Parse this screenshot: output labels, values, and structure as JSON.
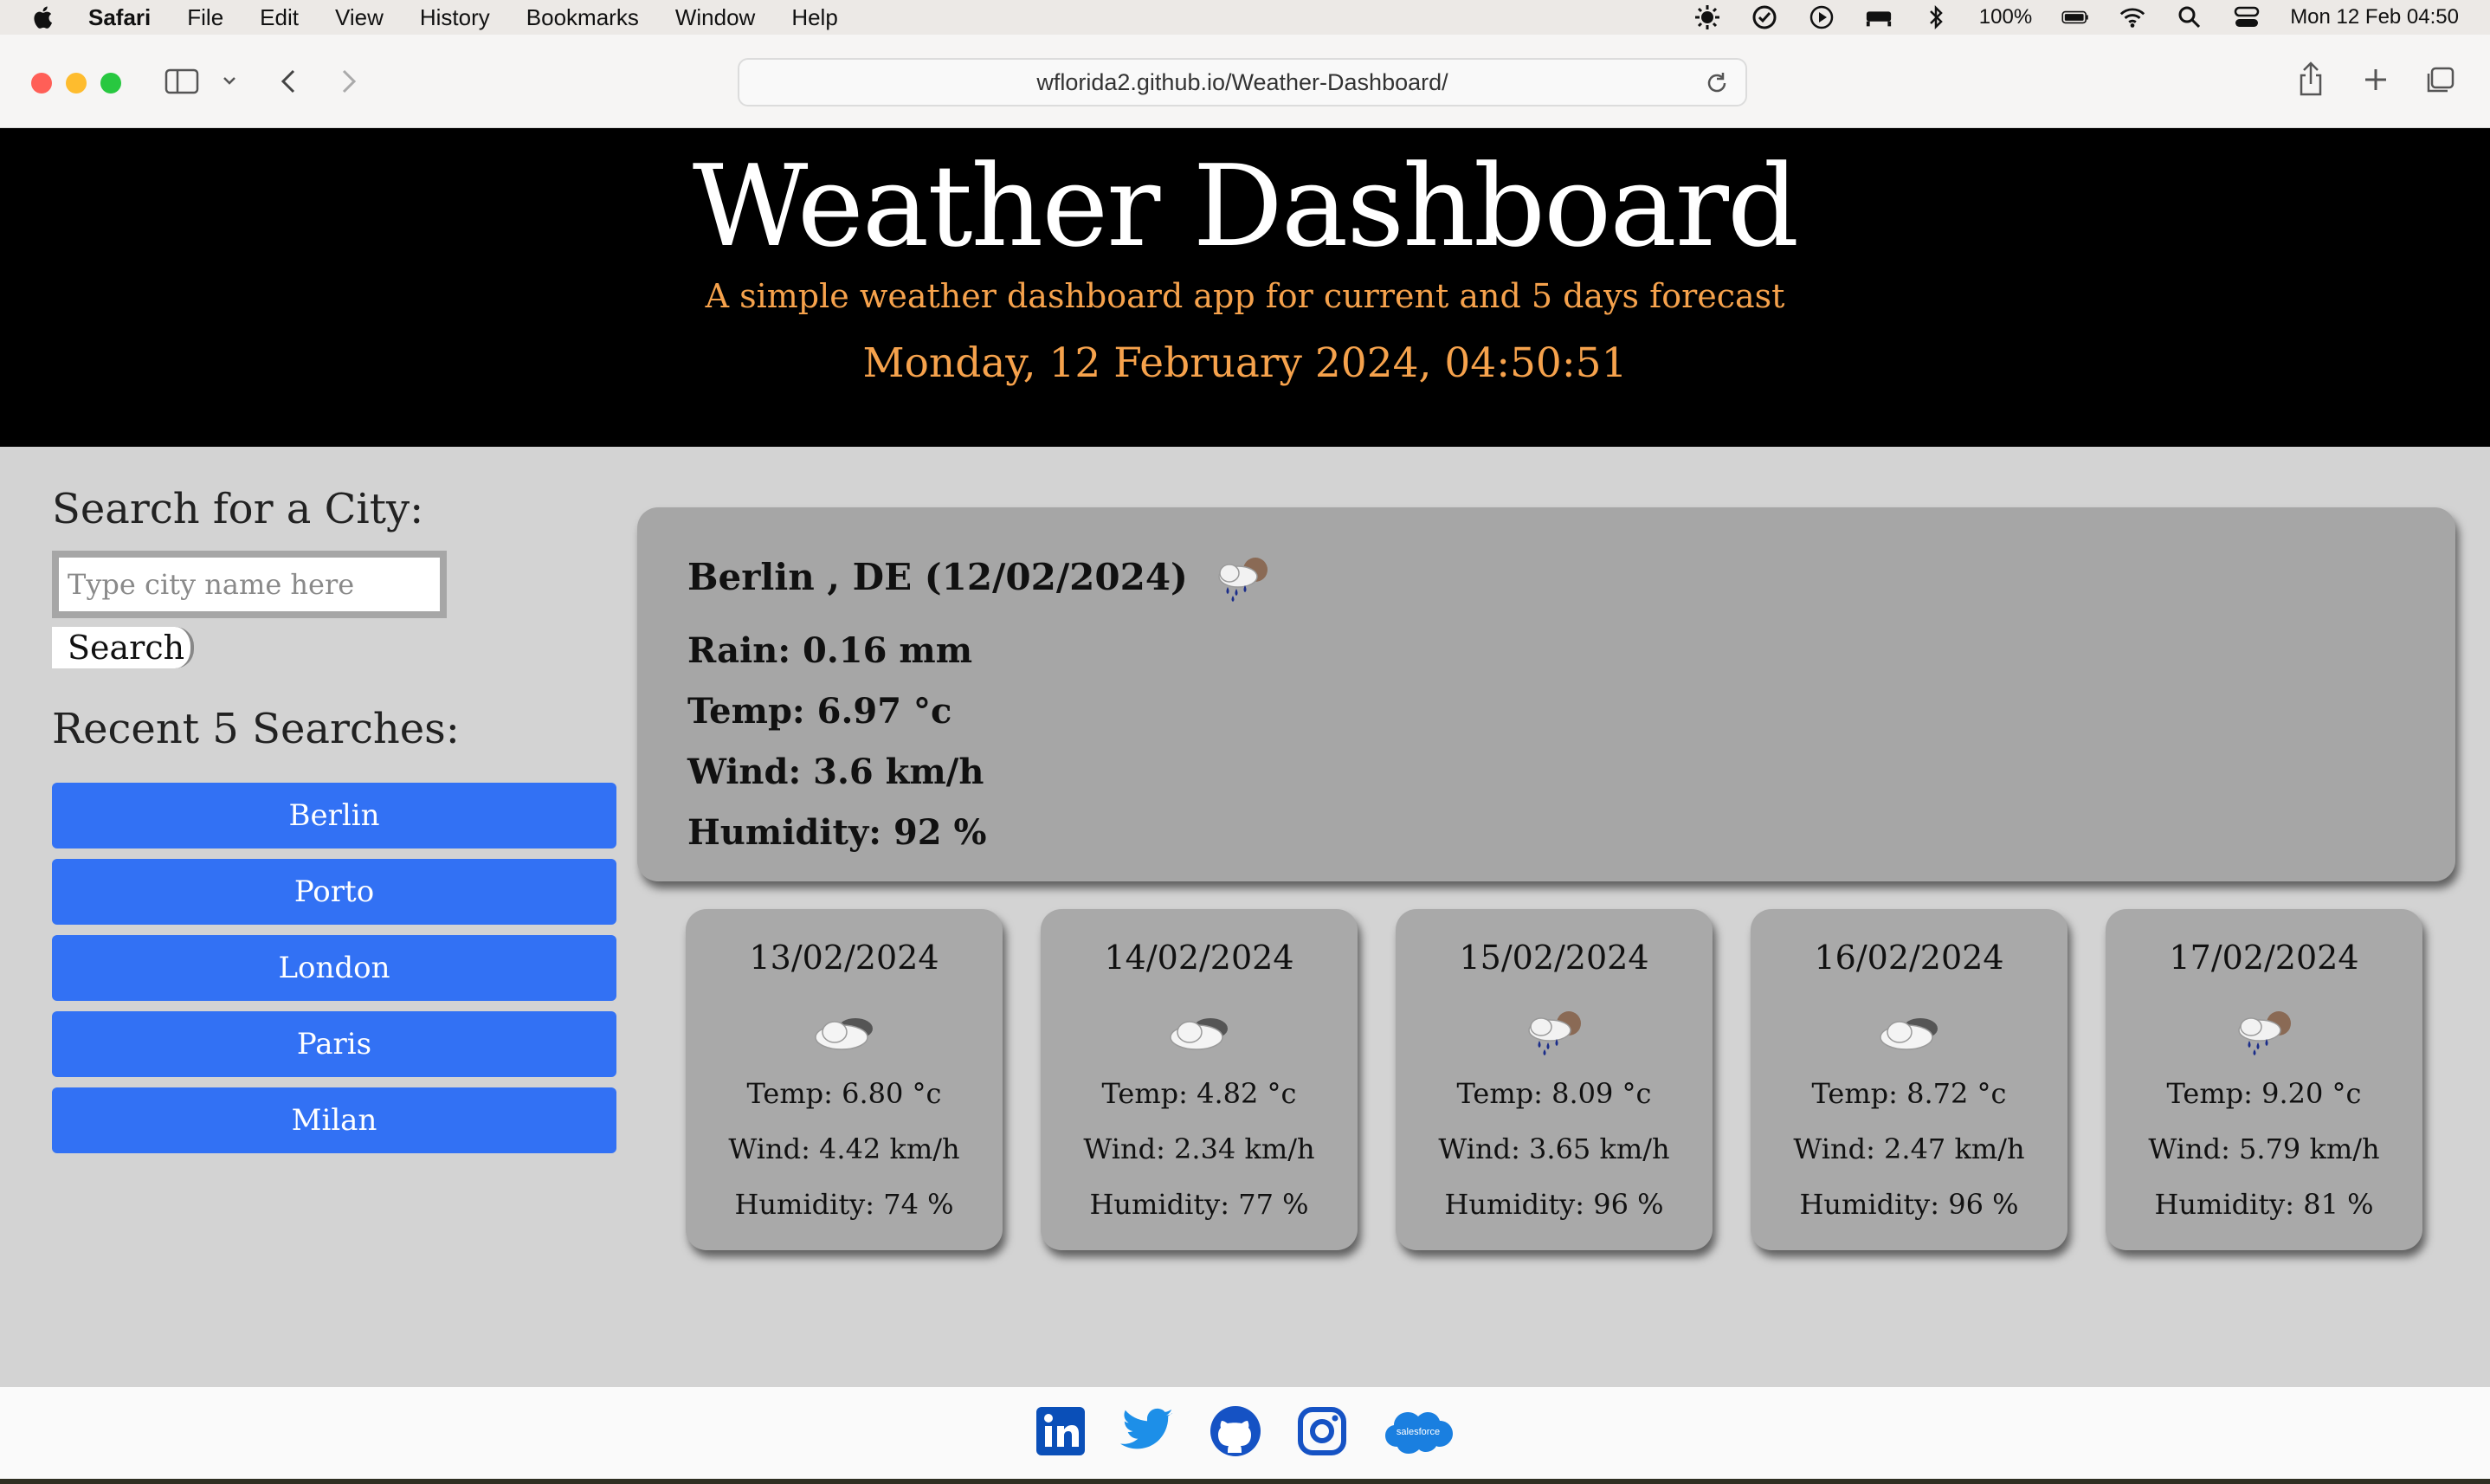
{
  "menubar": {
    "app_name": "Safari",
    "items": [
      "File",
      "Edit",
      "View",
      "History",
      "Bookmarks",
      "Window",
      "Help"
    ],
    "battery": "100%",
    "datetime": "Mon 12 Feb  04:50"
  },
  "browser": {
    "url": "wflorida2.github.io/Weather-Dashboard/"
  },
  "header": {
    "title": "Weather Dashboard",
    "subtitle": "A simple weather dashboard app for current and 5 days forecast",
    "datetime": "Monday, 12 February 2024, 04:50:51"
  },
  "sidebar": {
    "search_heading": "Search for a City:",
    "search_placeholder": "Type city name here",
    "search_button": "Search",
    "recent_heading": "Recent 5 Searches:",
    "recent": [
      "Berlin",
      "Porto",
      "London",
      "Paris",
      "Milan"
    ]
  },
  "current": {
    "city_line": "Berlin , DE (12/02/2024)",
    "icon": "rain-cloud-icon",
    "rain": "Rain: 0.16 mm",
    "temp": "Temp: 6.97 °c",
    "wind": "Wind: 3.6 km/h",
    "humidity": "Humidity: 92 %"
  },
  "forecast": [
    {
      "date": "13/02/2024",
      "icon": "cloud-icon",
      "temp": "Temp: 6.80 °c",
      "wind": "Wind: 4.42 km/h",
      "humidity": "Humidity: 74 %"
    },
    {
      "date": "14/02/2024",
      "icon": "cloud-icon",
      "temp": "Temp: 4.82 °c",
      "wind": "Wind: 2.34 km/h",
      "humidity": "Humidity: 77 %"
    },
    {
      "date": "15/02/2024",
      "icon": "rain-cloud-icon",
      "temp": "Temp: 8.09 °c",
      "wind": "Wind: 3.65 km/h",
      "humidity": "Humidity: 96 %"
    },
    {
      "date": "16/02/2024",
      "icon": "cloud-icon",
      "temp": "Temp: 8.72 °c",
      "wind": "Wind: 2.47 km/h",
      "humidity": "Humidity: 96 %"
    },
    {
      "date": "17/02/2024",
      "icon": "rain-cloud-icon",
      "temp": "Temp: 9.20 °c",
      "wind": "Wind: 5.79 km/h",
      "humidity": "Humidity: 81 %"
    }
  ],
  "footer": {
    "social": [
      "linkedin-icon",
      "twitter-icon",
      "github-icon",
      "instagram-icon",
      "salesforce-icon"
    ],
    "salesforce_text": "salesforce"
  },
  "colors": {
    "accent_orange": "#f6a24c",
    "button_blue": "#3271f4",
    "card_gray": "#a6a6a6",
    "background_gray": "#d3d3d3"
  }
}
